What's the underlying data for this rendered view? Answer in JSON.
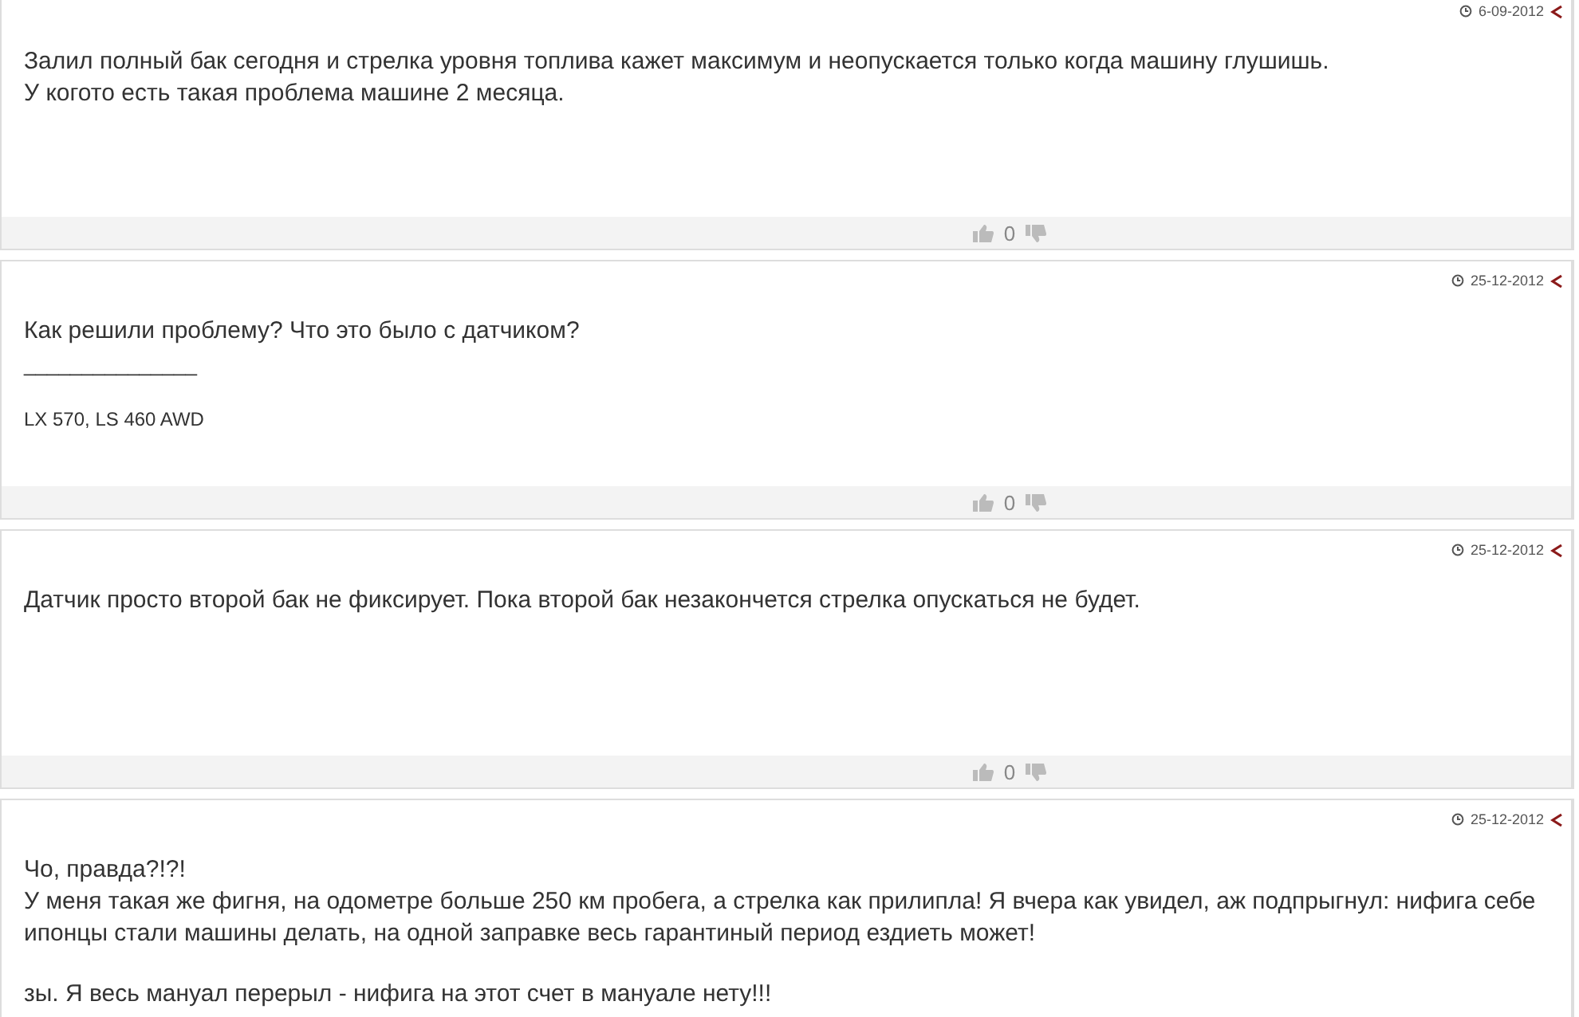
{
  "comments": [
    {
      "date": "6-09-2012",
      "paragraphs": [
        "Залил полный бак сегодня и стрелка уровня топлива кажет максимум и неопускается только когда машину глушишь.\nУ когото есть такая проблема машине 2 месяца."
      ],
      "votes": "0"
    },
    {
      "date": "25-12-2012",
      "paragraphs": [
        "Как решили проблему? Что это было с датчиком?"
      ],
      "signature_rule": "_______________",
      "signature": "LX 570, LS 460 AWD",
      "votes": "0"
    },
    {
      "date": "25-12-2012",
      "paragraphs": [
        "Датчик просто второй бак не фиксирует. Пока второй бак незакончется стрелка опускаться не будет."
      ],
      "votes": "0"
    },
    {
      "date": "25-12-2012",
      "paragraphs": [
        "Чо, правда?!?!\nУ меня такая же фигня, на одометре больше 250 км пробега, а стрелка как прилипла! Я вчера как увидел, аж подпрыгнул: нифига себе ипонцы стали машины делать, на одной заправке весь гарантиный период ездиеть может!",
        "зы. Я весь мануал перерыл - нифига на этот счет в мануале нету!!!"
      ]
    }
  ]
}
